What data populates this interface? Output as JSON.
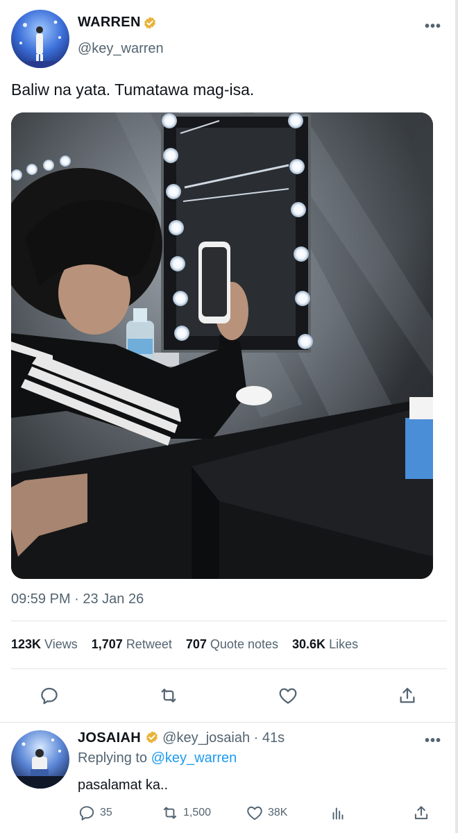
{
  "tweet": {
    "author_name": "WARREN",
    "author_handle": "@key_warren",
    "text": "Baliw na yata. Tumatawa mag-isa.",
    "timestamp": "09:59 PM · 23 Jan 26",
    "more_label": "•••",
    "stats": {
      "views_count": "123K",
      "views_label": "Views",
      "retweets_count": "1,707",
      "retweets_label": "Retweet",
      "quotes_count": "707",
      "quotes_label": "Quote notes",
      "likes_count": "30.6K",
      "likes_label": "Likes"
    },
    "actions": [
      "reply-icon",
      "retweet-icon",
      "like-icon",
      "share-icon"
    ]
  },
  "reply": {
    "author_name": "JOSAIAH",
    "author_handle": "@key_josaiah",
    "separator": "·",
    "time_ago": "41s",
    "replying_prefix": "Replying to",
    "replying_handle": "@key_warren",
    "text": "pasalamat ka..",
    "more_label": "•••",
    "reply_count": "35",
    "retweet_count": "1,500",
    "like_count": "38K"
  },
  "colors": {
    "accent": "#1d9bf0",
    "verified": "#e8b339",
    "muted": "#536471",
    "text": "#0f1419"
  }
}
